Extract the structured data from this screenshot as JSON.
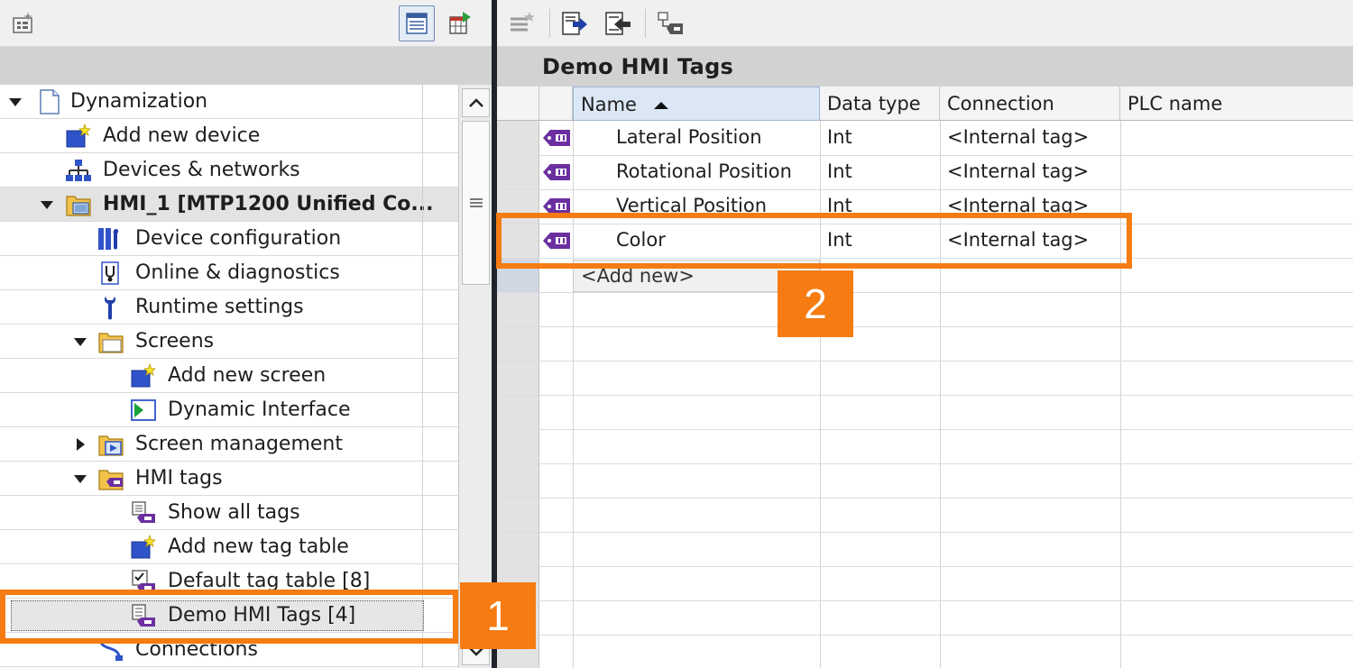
{
  "tree": {
    "items": [
      {
        "label": "Dynamization",
        "icon": "project-icon",
        "expander": "expanded"
      },
      {
        "label": "Add new device",
        "icon": "add-device-icon",
        "expander": "none"
      },
      {
        "label": "Devices & networks",
        "icon": "network-icon",
        "expander": "none"
      },
      {
        "label": "HMI_1 [MTP1200 Unified Co...",
        "icon": "hmi-device-icon",
        "expander": "expanded"
      },
      {
        "label": "Device configuration",
        "icon": "device-config-icon",
        "expander": "none"
      },
      {
        "label": "Online & diagnostics",
        "icon": "diagnostics-icon",
        "expander": "none"
      },
      {
        "label": "Runtime settings",
        "icon": "wrench-icon",
        "expander": "none"
      },
      {
        "label": "Screens",
        "icon": "folder-icon",
        "expander": "expanded"
      },
      {
        "label": "Add new screen",
        "icon": "add-screen-icon",
        "expander": "none"
      },
      {
        "label": "Dynamic Interface",
        "icon": "screen-icon",
        "expander": "none"
      },
      {
        "label": "Screen management",
        "icon": "screen-management-folder-icon",
        "expander": "collapsed"
      },
      {
        "label": "HMI tags",
        "icon": "tags-folder-icon",
        "expander": "expanded"
      },
      {
        "label": "Show all tags",
        "icon": "show-all-tags-icon",
        "expander": "none"
      },
      {
        "label": "Add new tag table",
        "icon": "add-tag-table-icon",
        "expander": "none"
      },
      {
        "label": "Default tag table [8]",
        "icon": "default-tag-table-icon",
        "expander": "none"
      },
      {
        "label": "Demo HMI Tags [4]",
        "icon": "tag-table-icon",
        "expander": "none"
      },
      {
        "label": "Connections",
        "icon": "connections-icon",
        "expander": "none"
      }
    ]
  },
  "table": {
    "title": "Demo HMI Tags",
    "columns": [
      "Name",
      "Data type",
      "Connection",
      "PLC name"
    ],
    "sort_column": "Name",
    "sort_direction": "ascending",
    "rows": [
      {
        "name": "Lateral Position",
        "data_type": "Int",
        "connection": "<Internal tag>",
        "plc_name": ""
      },
      {
        "name": "Rotational Position",
        "data_type": "Int",
        "connection": "<Internal tag>",
        "plc_name": ""
      },
      {
        "name": "Vertical Position",
        "data_type": "Int",
        "connection": "<Internal tag>",
        "plc_name": ""
      },
      {
        "name": "Color",
        "data_type": "Int",
        "connection": "<Internal tag>",
        "plc_name": ""
      }
    ],
    "add_new_label": "<Add new>"
  },
  "callouts": [
    {
      "number": "1",
      "target": "Demo HMI Tags [4]"
    },
    {
      "number": "2",
      "target": "Color"
    }
  ],
  "colors": {
    "callout": "#f57b12",
    "tag_icon": "#6b2fa0",
    "divider": "#20232b"
  }
}
